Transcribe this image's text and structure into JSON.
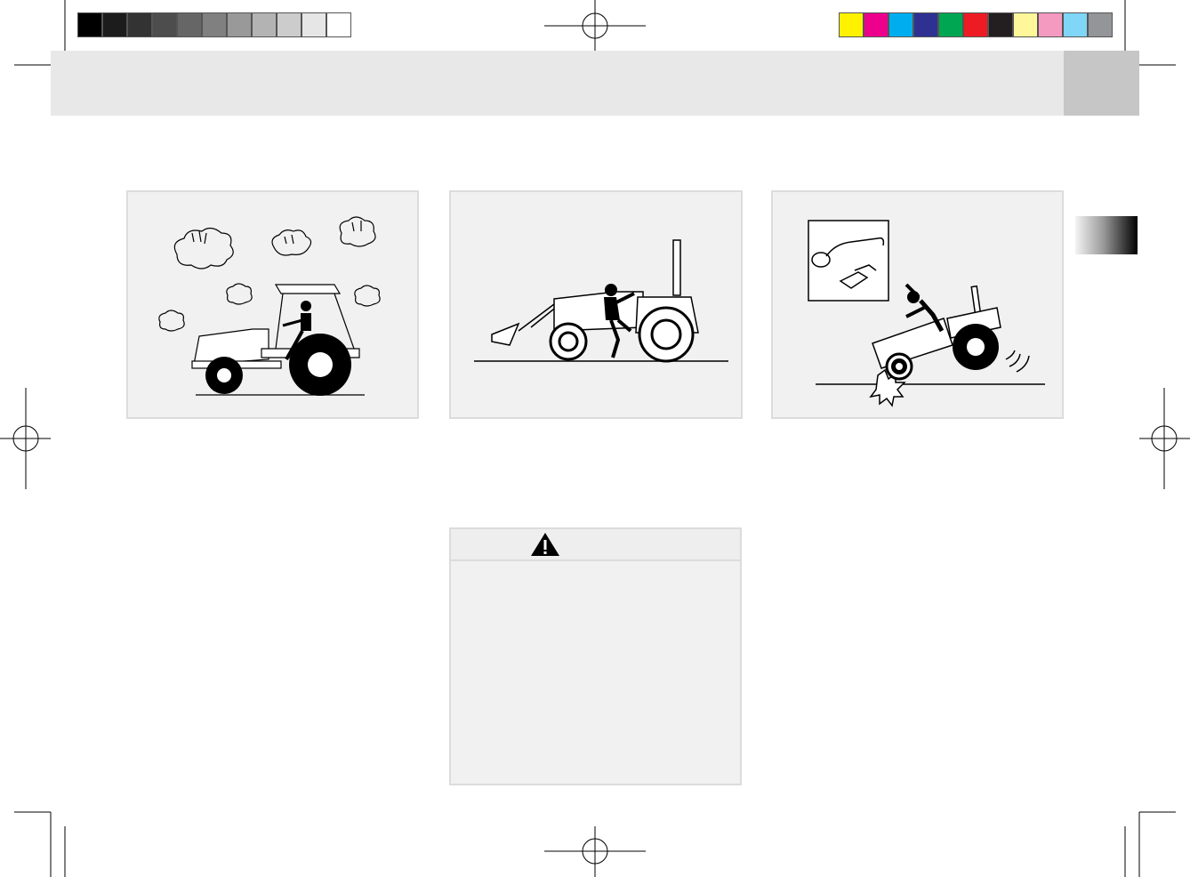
{
  "color_bar": {
    "grayscale": [
      "#000000",
      "#1c1c1c",
      "#333333",
      "#4d4d4d",
      "#666666",
      "#808080",
      "#999999",
      "#b3b3b3",
      "#cccccc",
      "#e6e6e6",
      "#ffffff"
    ],
    "process": [
      "#fff200",
      "#ec008c",
      "#00aeef",
      "#2e3192",
      "#00a651",
      "#ed1c24",
      "#231f20",
      "#fff799",
      "#f49ac1",
      "#7fd6f7",
      "#939598"
    ]
  },
  "header": {
    "band_color": "#e8e8e8",
    "tab_color": "#c6c6c6"
  },
  "figures": [
    {
      "id": "tractor-in-storm",
      "icon": "tractor-lightning-icon"
    },
    {
      "id": "mounting-tractor-loader",
      "icon": "operator-mounting-icon"
    },
    {
      "id": "tractor-overturn-warning",
      "icon": "tractor-rollover-icon"
    }
  ],
  "warning": {
    "icon": "warning-triangle-icon",
    "body_text": ""
  }
}
